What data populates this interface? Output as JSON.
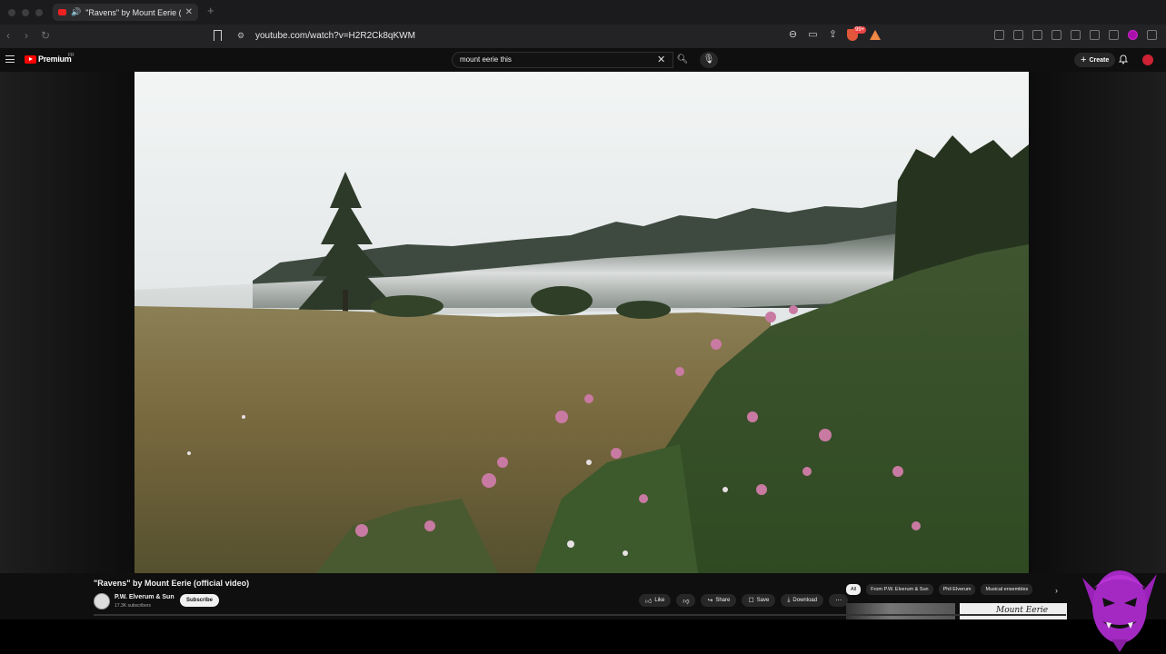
{
  "browser": {
    "tab_title": "\"Ravens\" by Mount Eerie (o",
    "url": "youtube.com/watch?v=H2R2Ck8qKWM",
    "shield_badge": "99+"
  },
  "masthead": {
    "logo_text": "Premium",
    "region": "FR",
    "search_value": "mount eerie this",
    "create_label": "Create"
  },
  "video": {
    "title": "\"Ravens\" by Mount Eerie (official video)",
    "channel_name": "P.W. Elverum & Sun",
    "subscribers": "17.3K subscribers",
    "subscribe_label": "Subscribe",
    "actions": {
      "like": "Like",
      "share": "Share",
      "save": "Save",
      "download": "Download"
    }
  },
  "chips": [
    "All",
    "From P.W. Elverum & Sun",
    "Phil Elverum",
    "Musical ensembles"
  ],
  "thumbnail_caption": "Mount Eerie"
}
